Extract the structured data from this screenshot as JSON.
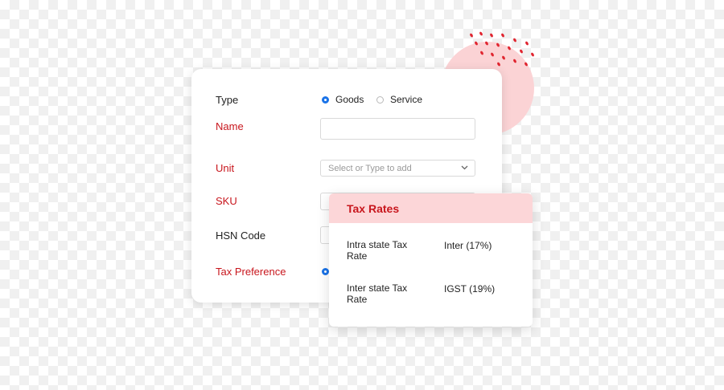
{
  "form": {
    "type_label": "Type",
    "type_options": [
      "Goods",
      "Service"
    ],
    "type_selected": "Goods",
    "name_label": "Name",
    "name_value": "",
    "unit_label": "Unit",
    "unit_placeholder": "Select or Type to add",
    "sku_label": "SKU",
    "hsn_label": "HSN Code",
    "tax_pref_label": "Tax Preference"
  },
  "tax_rates": {
    "title": "Tax Rates",
    "rows": [
      {
        "label": "Intra state Tax Rate",
        "value": "Inter (17%)"
      },
      {
        "label": "Inter state Tax Rate",
        "value": "IGST (19%)"
      }
    ]
  },
  "colors": {
    "accent_red": "#c8161d",
    "header_pink": "#fcd6d8",
    "radio_blue": "#1a73e8"
  },
  "icons": [
    "chevron-down-icon"
  ]
}
